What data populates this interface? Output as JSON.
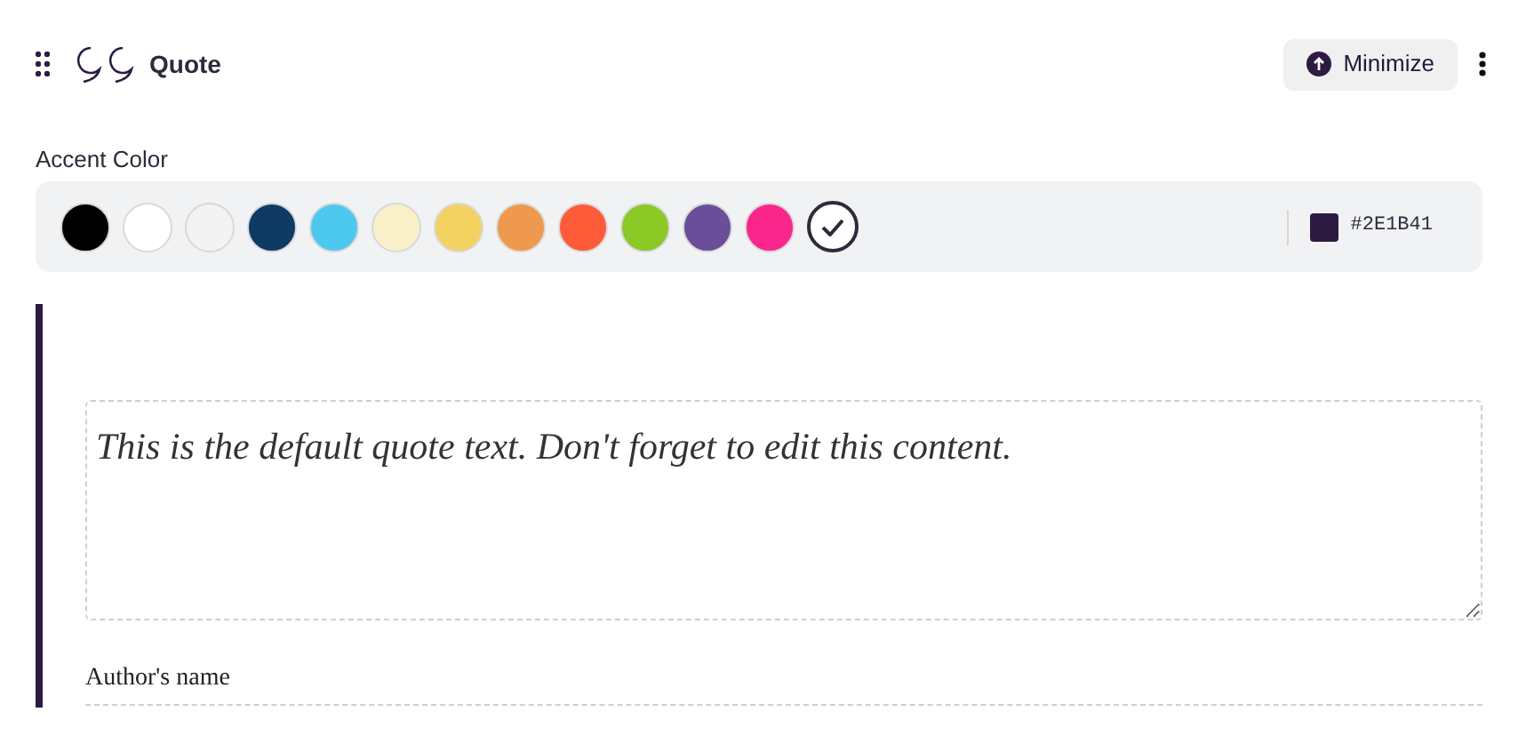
{
  "header": {
    "title": "Quote",
    "minimize_button": "Minimize"
  },
  "accent": {
    "label": "Accent Color",
    "value": "#2E1B41",
    "color": "#2e1b41",
    "swatches": [
      {
        "kind": "swatch",
        "color": "#000000",
        "selected": false
      },
      {
        "kind": "swatch",
        "color": "#ffffff",
        "selected": false
      },
      {
        "kind": "swatch",
        "color": "#f3f3f3",
        "selected": false
      },
      {
        "kind": "swatch",
        "color": "#0e3a63",
        "selected": false
      },
      {
        "kind": "swatch",
        "color": "#4dc9ef",
        "selected": false
      },
      {
        "kind": "swatch",
        "color": "#f9f0ca",
        "selected": false
      },
      {
        "kind": "swatch",
        "color": "#f4d261",
        "selected": false
      },
      {
        "kind": "swatch",
        "color": "#ee994d",
        "selected": false
      },
      {
        "kind": "swatch",
        "color": "#fe5b39",
        "selected": false
      },
      {
        "kind": "swatch",
        "color": "#8bc927",
        "selected": false
      },
      {
        "kind": "swatch",
        "color": "#6a4e99",
        "selected": false
      },
      {
        "kind": "swatch",
        "color": "#fa268c",
        "selected": false
      },
      {
        "kind": "custom",
        "selected": true
      }
    ]
  },
  "quote": {
    "text": "This is the default quote text. Don't forget to edit this content.",
    "author": "Author's name"
  }
}
